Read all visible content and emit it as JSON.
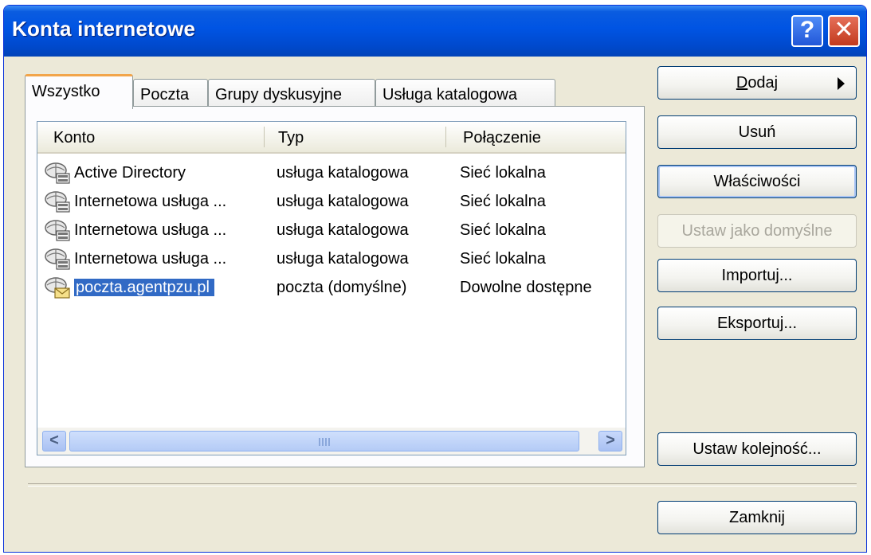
{
  "window": {
    "title": "Konta internetowe",
    "help_glyph": "?",
    "close_glyph": "✕"
  },
  "tabs": [
    {
      "label": "Wszystko",
      "active": true
    },
    {
      "label": "Poczta",
      "active": false
    },
    {
      "label": "Grupy dyskusyjne",
      "active": false
    },
    {
      "label": "Usługa katalogowa",
      "active": false
    }
  ],
  "list": {
    "columns": [
      "Konto",
      "Typ",
      "Połączenie"
    ],
    "rows": [
      {
        "name": "Active Directory",
        "type": "usługa katalogowa",
        "connection": "Sieć lokalna",
        "icon": "directory-service-icon"
      },
      {
        "name": "Internetowa usługa ...",
        "type": "usługa katalogowa",
        "connection": "Sieć lokalna",
        "icon": "directory-service-icon"
      },
      {
        "name": "Internetowa usługa ...",
        "type": "usługa katalogowa",
        "connection": "Sieć lokalna",
        "icon": "directory-service-icon"
      },
      {
        "name": "Internetowa usługa ...",
        "type": "usługa katalogowa",
        "connection": "Sieć lokalna",
        "icon": "directory-service-icon"
      },
      {
        "name": "poczta.agentpzu.pl",
        "type": "poczta (domyślne)",
        "connection": "Dowolne dostępne",
        "icon": "mail-account-icon",
        "selected": true
      }
    ],
    "scroll_left_glyph": "<",
    "scroll_right_glyph": ">"
  },
  "buttons": {
    "add_prefix": "",
    "add_mnemonic": "D",
    "add_rest": "odaj",
    "remove": "Usuń",
    "properties": "Właściwości",
    "set_default": "Ustaw jako domyślne",
    "import": "Importuj...",
    "export": "Eksportuj...",
    "set_order": "Ustaw kolejność...",
    "close": "Zamknij"
  },
  "colors": {
    "titlebar": "#0054e3",
    "selection": "#316ac5",
    "face": "#ece9d8"
  }
}
